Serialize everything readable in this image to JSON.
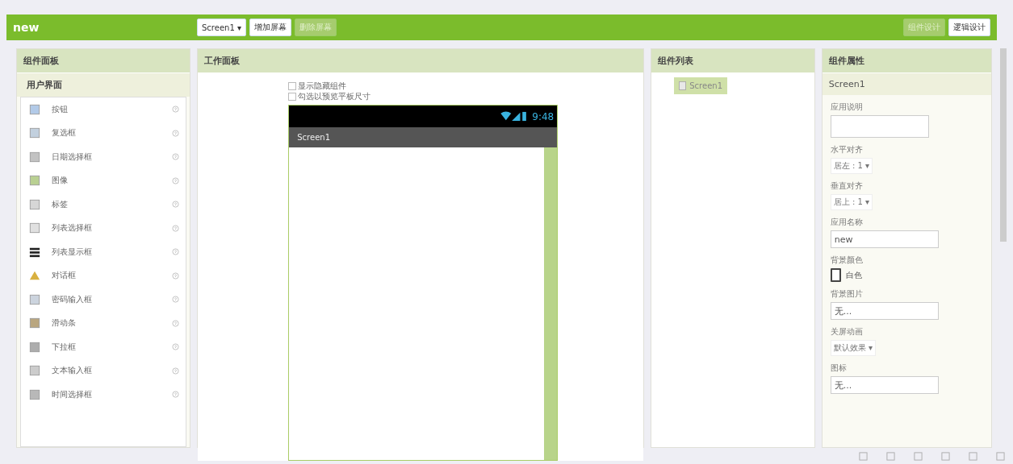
{
  "toolbar": {
    "project": "new",
    "screen_select": "Screen1 ▾",
    "buttons": [
      {
        "label": "增加屏幕",
        "disabled": false
      },
      {
        "label": "删除屏幕",
        "disabled": true
      }
    ],
    "views": [
      {
        "label": "组件设计",
        "selected": true
      },
      {
        "label": "逻辑设计",
        "selected": false
      }
    ]
  },
  "palette": {
    "title": "组件面板",
    "category": "用户界面",
    "items": [
      {
        "label": "按钮",
        "kind": "button"
      },
      {
        "label": "复选框",
        "kind": "checkbox"
      },
      {
        "label": "日期选择框",
        "kind": "date"
      },
      {
        "label": "图像",
        "kind": "image"
      },
      {
        "label": "标签",
        "kind": "label"
      },
      {
        "label": "列表选择框",
        "kind": "listpicker"
      },
      {
        "label": "列表显示框",
        "kind": "listview"
      },
      {
        "label": "对话框",
        "kind": "notifier"
      },
      {
        "label": "密码输入框",
        "kind": "password"
      },
      {
        "label": "滑动条",
        "kind": "slider"
      },
      {
        "label": "下拉框",
        "kind": "spinner"
      },
      {
        "label": "文本输入框",
        "kind": "textbox"
      },
      {
        "label": "时间选择框",
        "kind": "time"
      }
    ]
  },
  "viewer": {
    "title": "工作面板",
    "options": [
      {
        "label": "显示隐藏组件",
        "checked": false
      },
      {
        "label": "勾选以预览平板尺寸",
        "checked": false
      }
    ],
    "phone": {
      "time": "9:48",
      "screen_title": "Screen1"
    }
  },
  "components": {
    "title": "组件列表",
    "items": [
      {
        "label": "Screen1",
        "selected": true
      }
    ]
  },
  "properties": {
    "title": "组件属性",
    "component": "Screen1",
    "fields": [
      {
        "label": "应用说明",
        "kind": "textarea"
      },
      {
        "label": "水平对齐",
        "kind": "dropdown",
        "value": "居左 : 1 ▾"
      },
      {
        "label": "垂直对齐",
        "kind": "dropdown",
        "value": "居上 : 1 ▾"
      },
      {
        "label": "应用名称",
        "kind": "text",
        "value": "new"
      },
      {
        "label": "背景颜色",
        "kind": "color",
        "value": "白色",
        "color": "#ffffff"
      },
      {
        "label": "背景图片",
        "kind": "text",
        "value": "无..."
      },
      {
        "label": "关屏动画",
        "kind": "dropdown",
        "value": "默认效果 ▾"
      },
      {
        "label": "图标",
        "kind": "text",
        "value": "无..."
      }
    ]
  }
}
